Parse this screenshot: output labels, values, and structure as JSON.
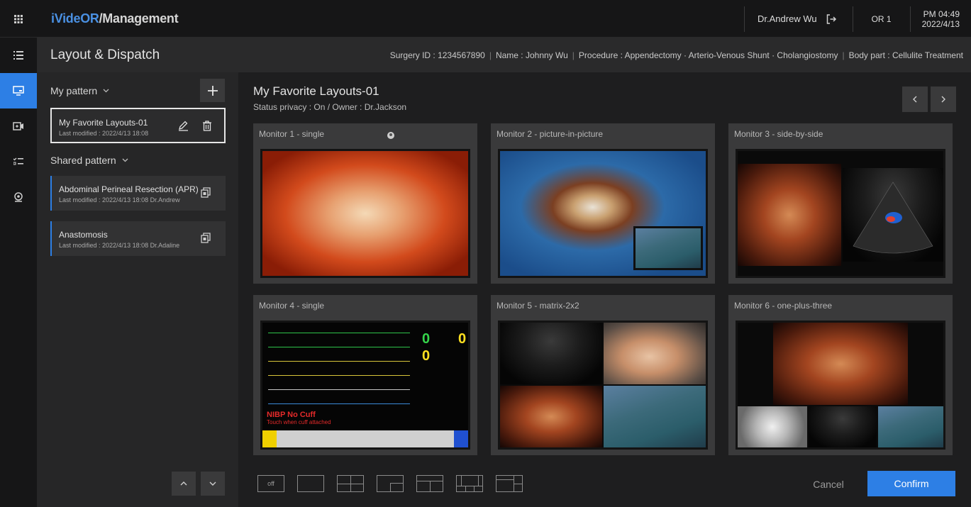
{
  "app": {
    "brand_part1": "iVideOR",
    "brand_part2": "/Management"
  },
  "topbar": {
    "user": "Dr.Andrew Wu",
    "room": "OR 1",
    "time": "PM 04:49",
    "date": "2022/4/13"
  },
  "header": {
    "title": "Layout & Dispatch",
    "surgery_id": "Surgery ID : 1234567890",
    "name": "Name : Johnny Wu",
    "procedure": "Procedure : Appendectomy · Arterio-Venous Shunt · Cholangiostomy",
    "body_part": "Body part : Cellulite Treatment"
  },
  "left": {
    "my_pattern_label": "My pattern",
    "shared_pattern_label": "Shared pattern",
    "my_patterns": [
      {
        "title": "My Favorite Layouts-01",
        "sub": "Last modified : 2022/4/13 18:08"
      }
    ],
    "shared_patterns": [
      {
        "title": "Abdominal Perineal Resection (APR)",
        "sub": "Last modified : 2022/4/13 18:08 Dr.Andrew"
      },
      {
        "title": "Anastomosis",
        "sub": "Last modified : 2022/4/13 18:08 Dr.Adaline"
      }
    ]
  },
  "main": {
    "layout_title": "My Favorite Layouts-01",
    "layout_sub": "Status privacy : On / Owner : Dr.Jackson",
    "monitors": [
      {
        "label": "Monitor 1 - single"
      },
      {
        "label": "Monitor 2 - picture-in-picture"
      },
      {
        "label": "Monitor 3 - side-by-side"
      },
      {
        "label": "Monitor 4 - single"
      },
      {
        "label": "Monitor 5  - matrix-2x2"
      },
      {
        "label": "Monitor 6 - one-plus-three"
      }
    ],
    "vitals": {
      "nibp_text": "NIBP No Cuff",
      "nibp_sub": "Touch when cuff attached",
      "hr": "0",
      "spo2": "0"
    },
    "tools": {
      "off_label": "off"
    },
    "cancel": "Cancel",
    "confirm": "Confirm"
  },
  "colors": {
    "accent": "#2d7fe5",
    "background": "#1b1b1c"
  }
}
